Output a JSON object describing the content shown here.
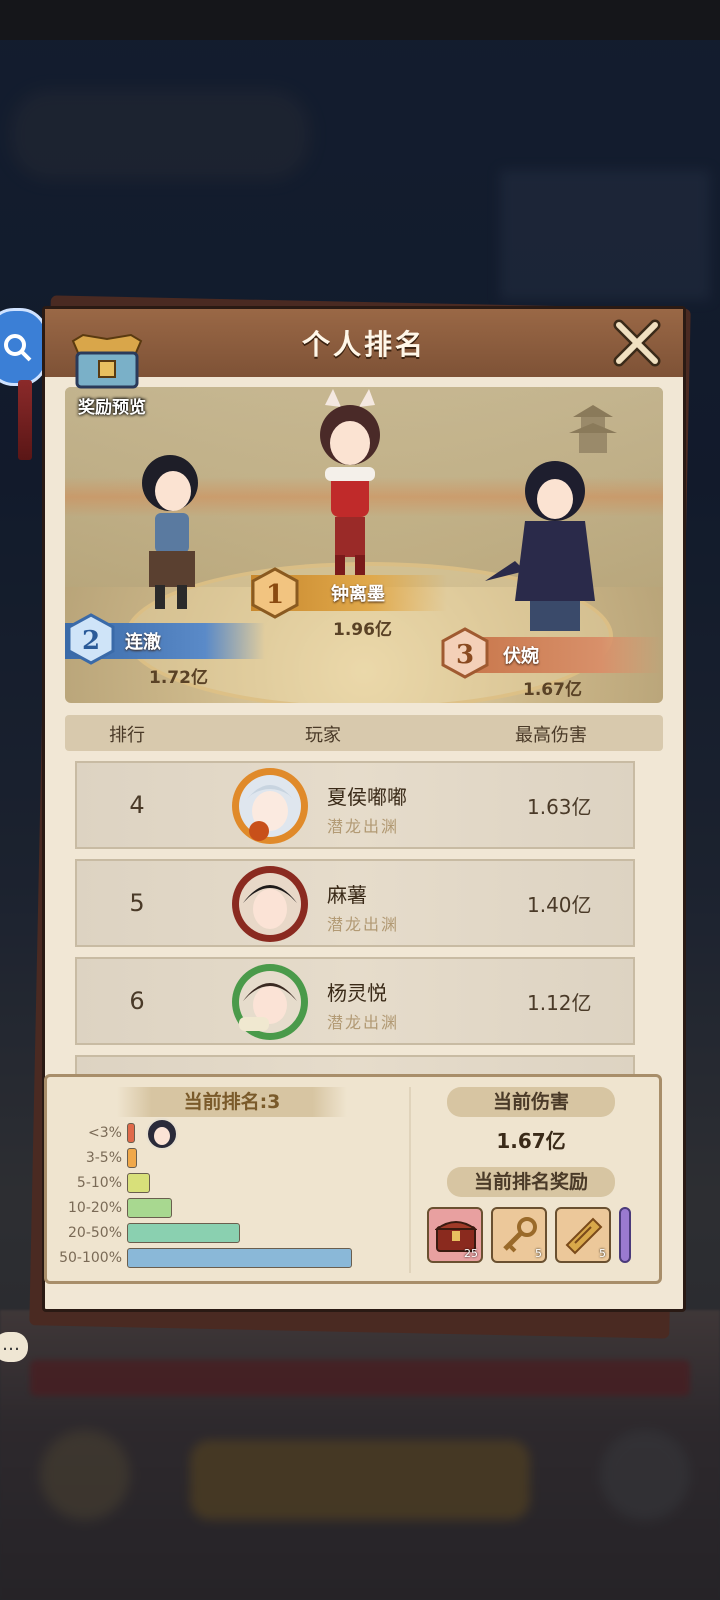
{
  "panel": {
    "title": "个人排名",
    "reward_preview_label": "奖励预览"
  },
  "podium": {
    "first": {
      "rank": "1",
      "name": "钟离墨",
      "damage": "1.96亿"
    },
    "second": {
      "rank": "2",
      "name": "连澈",
      "damage": "1.72亿"
    },
    "third": {
      "rank": "3",
      "name": "伏婉",
      "damage": "1.67亿"
    }
  },
  "table": {
    "headers": {
      "rank": "排行",
      "player": "玩家",
      "damage": "最高伤害"
    },
    "rows": [
      {
        "rank": "4",
        "name": "夏侯嘟嘟",
        "title": "潜龙出渊",
        "damage": "1.63亿",
        "frame_color": "#e08a2a"
      },
      {
        "rank": "5",
        "name": "麻薯",
        "title": "潜龙出渊",
        "damage": "1.40亿",
        "frame_color": "#8a2a20"
      },
      {
        "rank": "6",
        "name": "杨灵悦",
        "title": "潜龙出渊",
        "damage": "1.12亿",
        "frame_color": "#4a9a4a"
      }
    ]
  },
  "current": {
    "rank_label": "当前排名:3",
    "damage_title": "当前伤害",
    "damage_value": "1.67亿",
    "reward_title": "当前排名奖励",
    "distribution": [
      {
        "label": "<3%",
        "fraction": 0.02,
        "color": "#e06a4a"
      },
      {
        "label": "3-5%",
        "fraction": 0.04,
        "color": "#f0a84a"
      },
      {
        "label": "5-10%",
        "fraction": 0.09,
        "color": "#d8e07a"
      },
      {
        "label": "10-20%",
        "fraction": 0.18,
        "color": "#a8d890"
      },
      {
        "label": "20-50%",
        "fraction": 0.45,
        "color": "#8ad0b0"
      },
      {
        "label": "50-100%",
        "fraction": 0.9,
        "color": "#8ab8d8"
      }
    ],
    "rewards": [
      {
        "name": "chest-icon",
        "count": "25"
      },
      {
        "name": "key-icon",
        "count": "5"
      },
      {
        "name": "scroll-icon",
        "count": "5"
      }
    ]
  }
}
